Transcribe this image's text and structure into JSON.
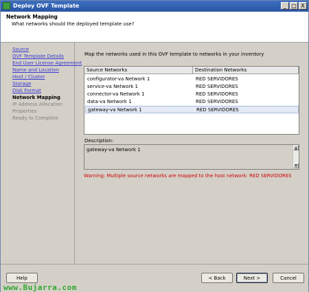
{
  "window": {
    "title": "Deploy OVF Template",
    "controls": {
      "minimize": "_",
      "maximize": "□",
      "close": "X"
    }
  },
  "header": {
    "title": "Network Mapping",
    "subtitle": "What networks should the deployed template use?"
  },
  "nav": {
    "items": [
      {
        "label": "Source",
        "state": "link"
      },
      {
        "label": "OVF Template Details",
        "state": "link"
      },
      {
        "label": "End User License Agreement",
        "state": "link"
      },
      {
        "label": "Name and Location",
        "state": "link"
      },
      {
        "label": "Host / Cluster",
        "state": "link"
      },
      {
        "label": "Storage",
        "state": "link"
      },
      {
        "label": "Disk Format",
        "state": "link"
      },
      {
        "label": "Network Mapping",
        "state": "current"
      },
      {
        "label": "IP Address Allocation",
        "state": "disabled"
      },
      {
        "label": "Properties",
        "state": "disabled"
      },
      {
        "label": "Ready to Complete",
        "state": "disabled"
      }
    ]
  },
  "main": {
    "intro": "Map the networks used in this OVF template to networks in your inventory",
    "table": {
      "headers": [
        "Source Networks",
        "Destination Networks"
      ],
      "rows": [
        {
          "source": "configurator-va Network 1",
          "destination": "RED SERVIDORES"
        },
        {
          "source": "service-va Network 1",
          "destination": "RED SERVIDORES"
        },
        {
          "source": "connector-va Network 1",
          "destination": "RED SERVIDORES"
        },
        {
          "source": "data-va Network 1",
          "destination": "RED SERVIDORES"
        },
        {
          "source": "gateway-va Network 1",
          "destination": "RED SERVIDORES"
        }
      ],
      "selected_index": 4
    },
    "description_label": "Description:",
    "description_text": "gateway-va Network 1",
    "warning": "Warning: Multiple source networks are mapped to the host network: RED SERVIDORES"
  },
  "footer": {
    "help": "Help",
    "back": "< Back",
    "next": "Next >",
    "cancel": "Cancel",
    "watermark": "www.Bujarra.com"
  },
  "colors": {
    "titlebar": "#2a56a4",
    "link": "#3a3ad0",
    "warning": "#d00000",
    "watermark": "#2fa82f"
  }
}
